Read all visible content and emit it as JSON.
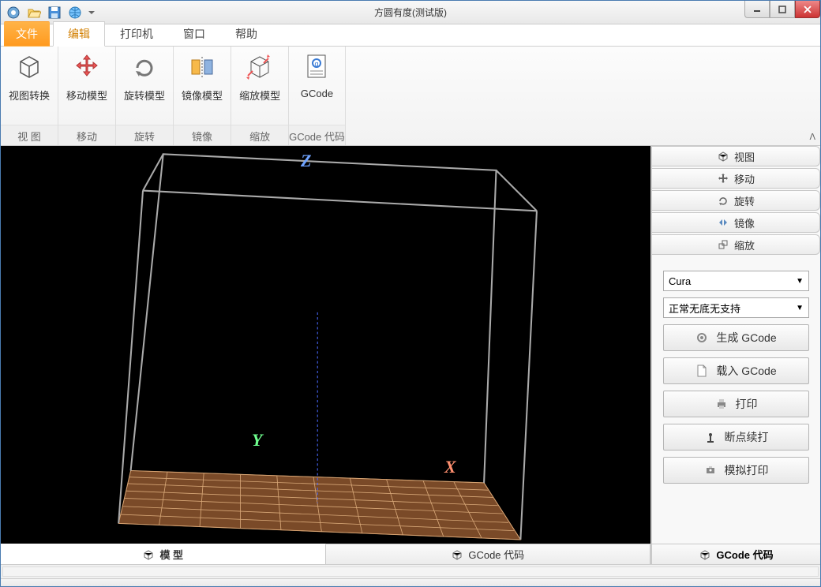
{
  "window": {
    "title": "方圆有度(测试版)"
  },
  "menutabs": {
    "file": "文件",
    "items": [
      "编辑",
      "打印机",
      "窗口",
      "帮助"
    ],
    "active_index": 0
  },
  "ribbon": {
    "groups": [
      {
        "label": "视 图",
        "items": [
          {
            "label": "视图转换",
            "icon": "cube"
          }
        ]
      },
      {
        "label": "移动",
        "items": [
          {
            "label": "移动模型",
            "icon": "move"
          }
        ]
      },
      {
        "label": "旋转",
        "items": [
          {
            "label": "旋转模型",
            "icon": "rotate"
          }
        ]
      },
      {
        "label": "镜像",
        "items": [
          {
            "label": "镜像模型",
            "icon": "mirror"
          }
        ]
      },
      {
        "label": "缩放",
        "items": [
          {
            "label": "缩放模型",
            "icon": "scale"
          }
        ]
      },
      {
        "label": "GCode 代码",
        "items": [
          {
            "label": "GCode",
            "icon": "gcode"
          }
        ]
      }
    ]
  },
  "viewport": {
    "axes": {
      "x": "X",
      "y": "Y",
      "z": "Z"
    }
  },
  "bottom_tabs": [
    {
      "label": "模 型",
      "icon": "cube"
    },
    {
      "label": "GCode 代码",
      "icon": "cube"
    }
  ],
  "right_panel": {
    "tabs": [
      {
        "label": "视图",
        "icon": "cube"
      },
      {
        "label": "移动",
        "icon": "move"
      },
      {
        "label": "旋转",
        "icon": "rotate"
      },
      {
        "label": "镜像",
        "icon": "mirror"
      },
      {
        "label": "缩放",
        "icon": "scale"
      }
    ],
    "slicer_select": "Cura",
    "profile_select": "正常无底无支持",
    "buttons": [
      {
        "label": "生成 GCode",
        "icon": "gear"
      },
      {
        "label": "载入 GCode",
        "icon": "doc"
      },
      {
        "label": "打印",
        "icon": "printer"
      },
      {
        "label": "断点续打",
        "icon": "resume"
      },
      {
        "label": "模拟打印",
        "icon": "sim"
      }
    ],
    "bottom_tab": "GCode 代码"
  }
}
